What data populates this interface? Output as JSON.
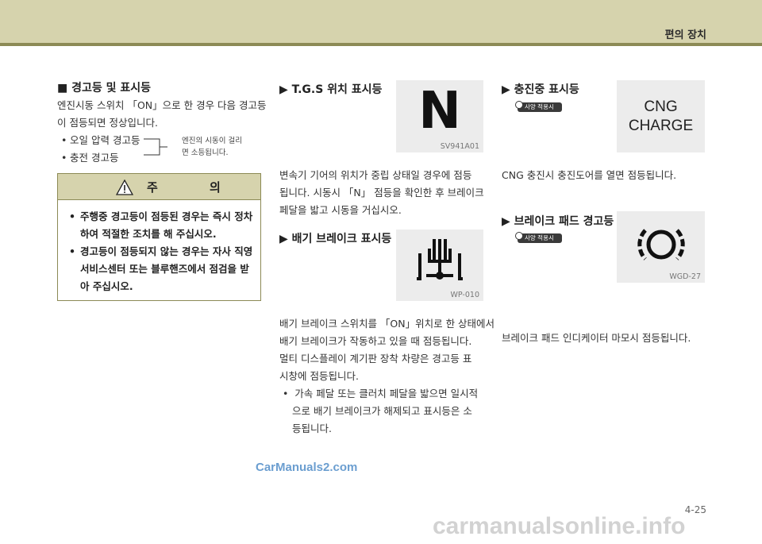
{
  "header": {
    "title": "편의 장치"
  },
  "warning_section": {
    "title": "■ 경고등 및 표시등",
    "intro": [
      "엔진시동 스위치 「ON」으로 한 경우 다음 경고등",
      "이 점등되면 정상입니다."
    ],
    "items": [
      "오일 압력 경고등",
      "충전 경고등"
    ],
    "note": [
      "엔진의 시동이 걸리",
      "면 소등됩니다."
    ]
  },
  "caution": {
    "title": "주 의",
    "items": [
      [
        "주행중 경고등이 점등된 경우는 즉시 정차",
        "하여 적절한 조치를 해 주십시오."
      ],
      [
        "경고등이 점등되지 않는 경우는 자사 직영",
        "서비스센터 또는 블루핸즈에서 점검을 받",
        "아 주십시오."
      ]
    ]
  },
  "tgs": {
    "title": "▶ T.G.S 위치 표시등",
    "icon_letter": "N",
    "code": "SV941A01",
    "text": [
      "변속기 기어의 위치가 중립 상태일 경우에 점등",
      "됩니다. 시동시 「N」 점등을 확인한 후 브레이크",
      "페달을 밟고 시동을 거십시오."
    ]
  },
  "exhaust_brake": {
    "title": "▶ 배기 브레이크 표시등",
    "code": "WP-010",
    "text": [
      "배기 브레이크 스위치를 「ON」위치로 한 상태에서",
      "배기 브레이크가 작동하고 있을 때 점등됩니다.",
      "멀티 디스플레이 계기판 장착 차량은 경고등 표",
      "시창에 점등됩니다."
    ],
    "bullet": [
      "가속 페달 또는 클러치 페달을 밟으면 일시적",
      "으로 배기 브레이크가 해제되고 표시등은 소",
      "등됩니다."
    ]
  },
  "cng": {
    "title": "▶ 충진중 표시등",
    "badge": "사양 적용시",
    "icon_lines": [
      "CNG",
      "CHARGE"
    ],
    "text": "CNG 충진시 충진도어를 열면 점등됩니다."
  },
  "brake_pad": {
    "title": "▶ 브레이크 패드 경고등",
    "badge": "사양 적용시",
    "code": "WGD-27",
    "text": "브레이크 패드 인디케이터 마모시 점등됩니다."
  },
  "watermark": "CarManuals2.com",
  "page_number": "4-25",
  "footer_mark": "carmanualsonline.info"
}
